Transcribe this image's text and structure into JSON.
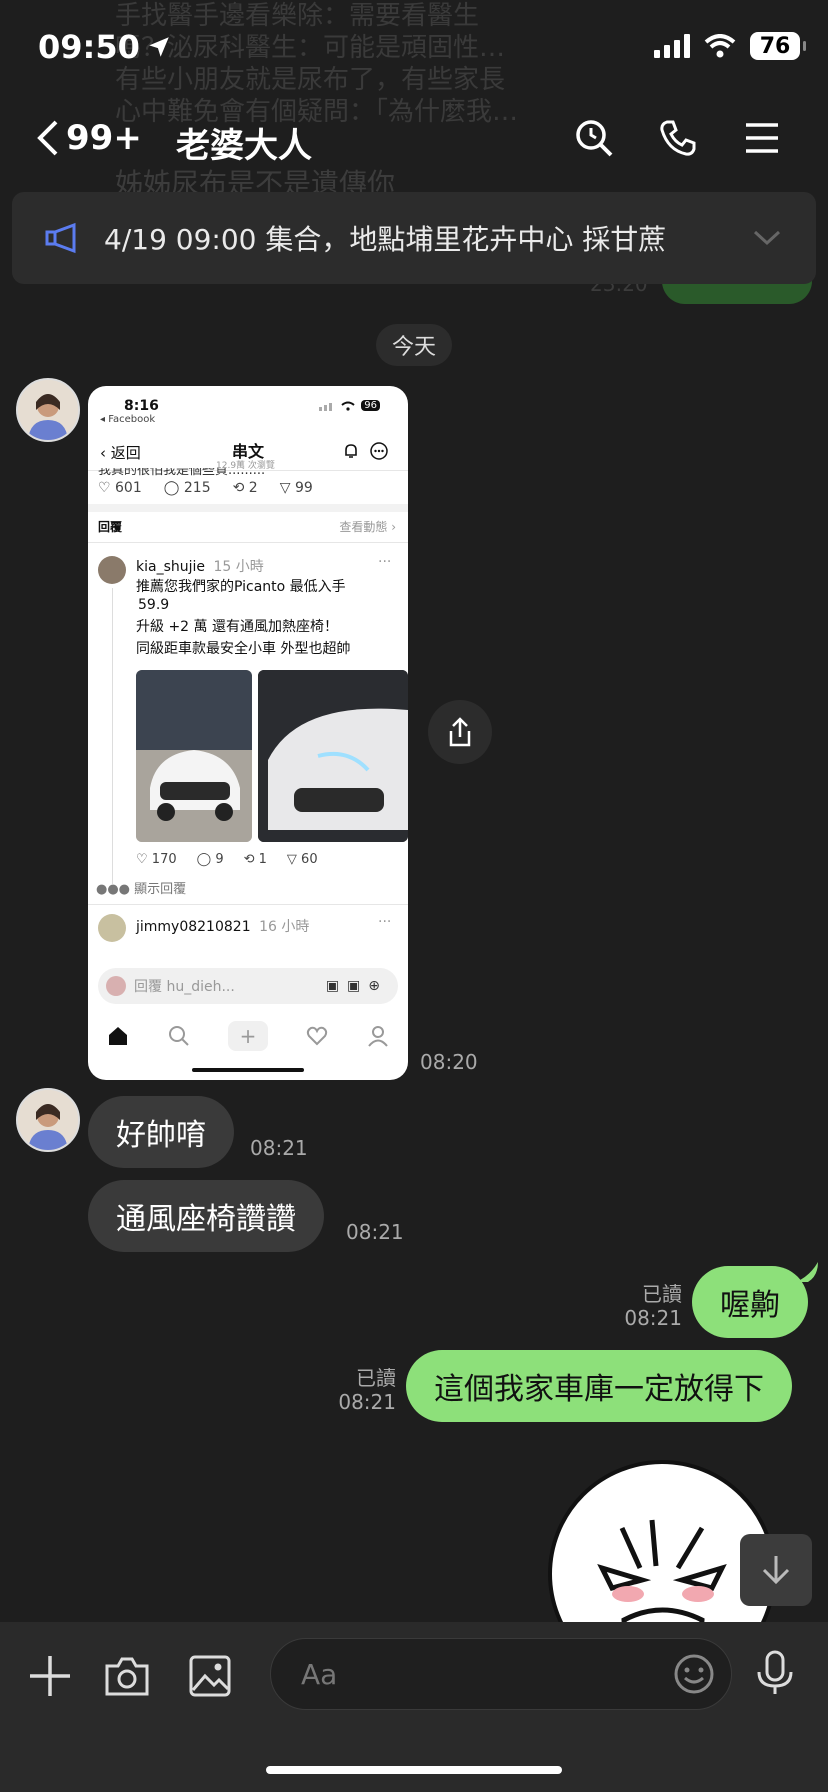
{
  "status_bar": {
    "time": "09:50",
    "battery": "76"
  },
  "background_chat": {
    "lines": [
      "手找醫手邊看樂除：需要看醫生",
      "嗎？泌尿科醫生：可能是頑固性…",
      "有些小朋友就是尿布了，有些家長",
      "心中難免會有個疑問：「為什麼我…"
    ],
    "line2": "姊姊尿布是不是遺傳你",
    "time": "23:20"
  },
  "header": {
    "back_count": "99+",
    "title": "老婆大人"
  },
  "announcement": {
    "text": "4/19 09:00 集合，地點埔里花卉中心 採甘蔗"
  },
  "date_separator": "今天",
  "shared_screenshot": {
    "status_time": "8:16",
    "status_app": "◂ Facebook",
    "status_battery": "96",
    "nav_back": "返回",
    "nav_title": "串文",
    "nav_sub": "12.9萬 次瀏覽",
    "clipped_text": "我真的很怕我是個些質.........",
    "post_stats": {
      "likes": "601",
      "comments": "215",
      "reposts": "2",
      "shares": "99"
    },
    "replies_label": "回覆",
    "view_activity": "查看動態 ›",
    "reply1": {
      "user": "kia_shujie",
      "time": "15 小時",
      "line1": "推薦您我們家的Picanto  最低入手",
      "line2": "59.9",
      "line3": "升級 +2 萬  還有通風加熱座椅！",
      "line4": "同級距車款最安全小車  外型也超帥",
      "stats": {
        "likes": "170",
        "comments": "9",
        "reposts": "1",
        "shares": "60"
      }
    },
    "show_replies": "顯示回覆",
    "reply2": {
      "user": "jimmy08210821",
      "time": "16 小時"
    },
    "reply_placeholder": "回覆 hu_dieh..."
  },
  "messages": {
    "screenshot_time": "08:20",
    "in1": {
      "text": "好帥唷",
      "time": "08:21"
    },
    "in2": {
      "text": "通風座椅讚讚",
      "time": "08:21"
    },
    "out1": {
      "read": "已讀",
      "time": "08:21",
      "text": "喔齁"
    },
    "out2": {
      "read": "已讀",
      "time": "08:21",
      "text": "這個我家車庫一定放得下"
    }
  },
  "input": {
    "placeholder": "Aa"
  },
  "colors": {
    "background": "#1e1e1e",
    "outgoing_bubble": "#8de07a",
    "incoming_bubble": "#3a3a3a",
    "announce_icon": "#5b7cf0"
  }
}
